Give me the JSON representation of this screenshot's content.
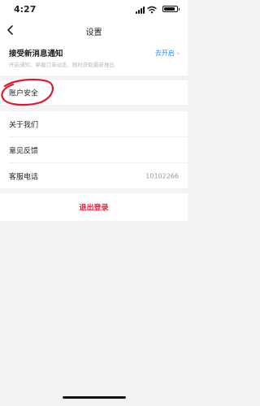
{
  "status_bar": {
    "time": "4:27"
  },
  "header": {
    "title": "设置"
  },
  "notification": {
    "title": "接受新消息通知",
    "subtitle": "开启通知，掌握订单动态，随时获取最新推出",
    "action_label": "去开启",
    "accent_color": "#2d8cf0"
  },
  "settings": {
    "account_security": "账户安全",
    "about_us": "关于我们",
    "feedback": "意见反馈",
    "service_phone_label": "客服电话",
    "service_phone_value": "10102266"
  },
  "logout": {
    "label": "退出登录",
    "color": "#e8213a"
  },
  "annotation": {
    "color": "#e0182d",
    "shape": "hand-drawn circle around 账户安全"
  }
}
